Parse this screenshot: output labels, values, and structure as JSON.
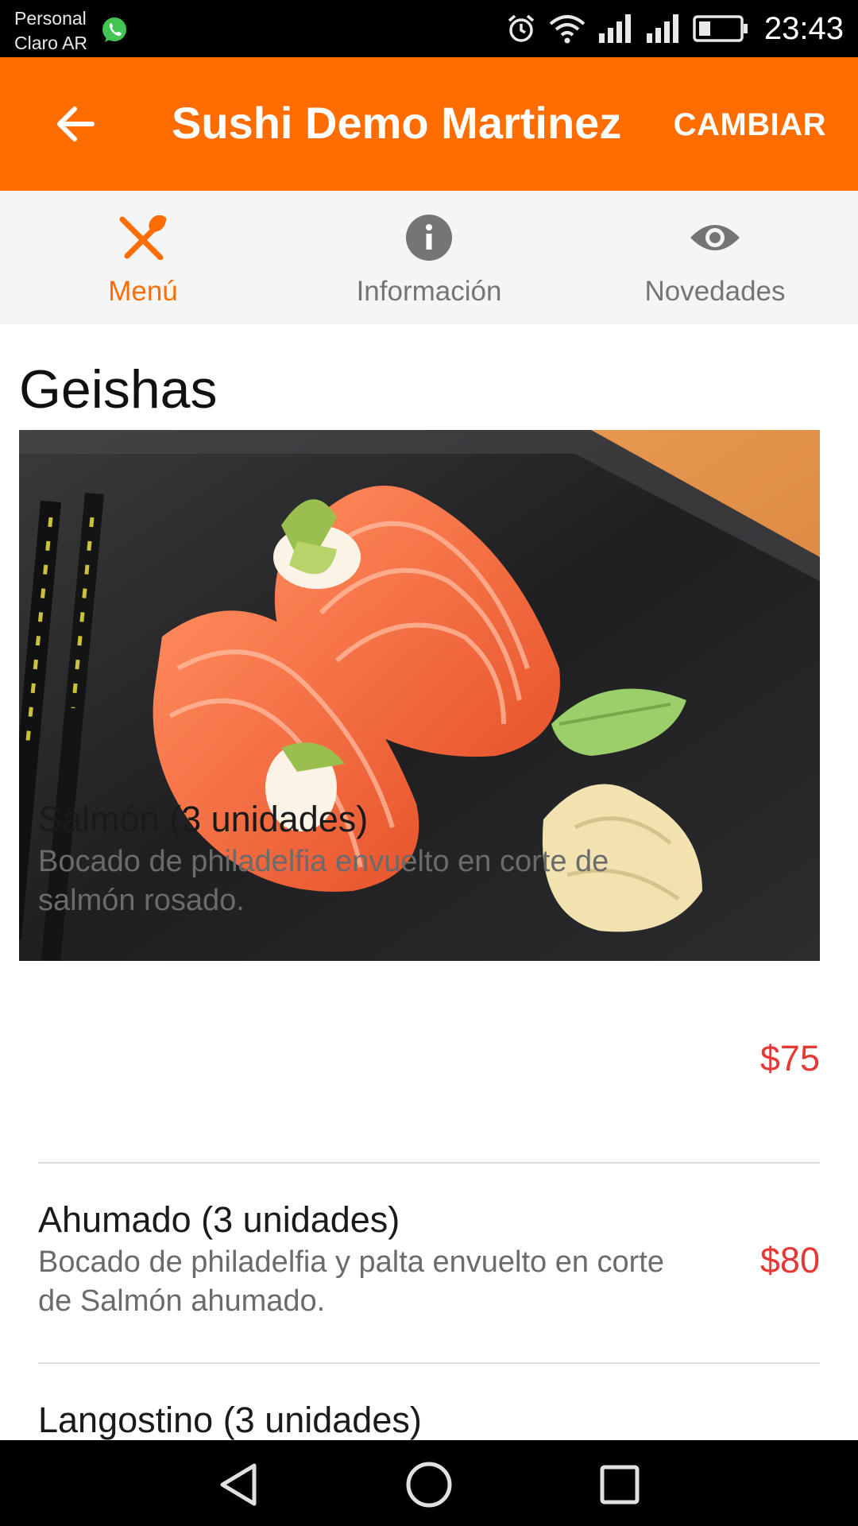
{
  "status_bar": {
    "carrier_line1": "Personal",
    "carrier_line2": "Claro AR",
    "time": "23:43",
    "icons": [
      "whatsapp-icon",
      "alarm-icon",
      "wifi-icon",
      "signal-icon",
      "signal-icon",
      "battery-icon"
    ]
  },
  "app_bar": {
    "title": "Sushi Demo Martinez",
    "action_label": "CAMBIAR",
    "back_icon": "arrow-back-icon",
    "color": "#ff6d00"
  },
  "tabs": [
    {
      "label": "Menú",
      "icon": "fork-spoon-icon",
      "active": true
    },
    {
      "label": "Información",
      "icon": "info-icon",
      "active": false
    },
    {
      "label": "Novedades",
      "icon": "eye-icon",
      "active": false
    }
  ],
  "section": {
    "title": "Geishas",
    "image": "salmon-geisha-photo"
  },
  "items": [
    {
      "name": "Salmón (3 unidades)",
      "description": "Bocado de philadelfia envuelto en corte de salmón rosado.",
      "price": "$75"
    },
    {
      "name": "Ahumado (3 unidades)",
      "description": "Bocado de philadelfia y palta envuelto en corte de Salmón ahumado.",
      "price": "$80"
    },
    {
      "name": "Langostino (3 unidades)",
      "description": "",
      "price": ""
    }
  ],
  "colors": {
    "accent": "#ff6d00",
    "price": "#e53935",
    "inactive_tab": "#757575"
  }
}
